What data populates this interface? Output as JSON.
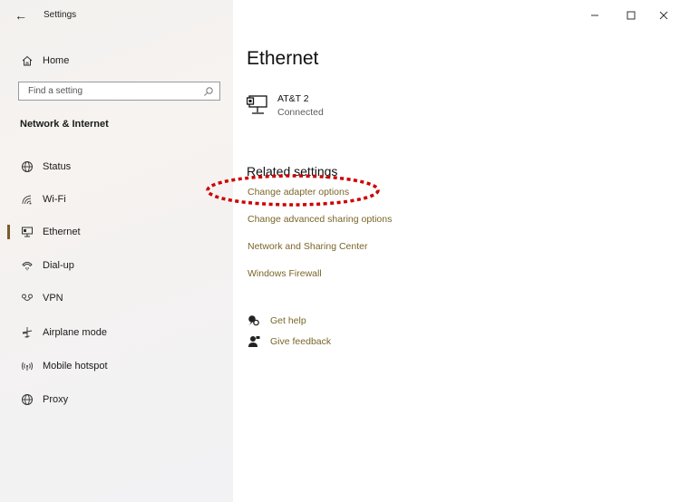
{
  "titlebar": {
    "back_icon": "back-arrow-icon",
    "title": "Settings"
  },
  "window_controls": {
    "minimize": "minimize-icon",
    "maximize": "maximize-icon",
    "close": "close-icon"
  },
  "sidebar": {
    "home_label": "Home",
    "search": {
      "placeholder": "Find a setting",
      "value": ""
    },
    "section_header": "Network & Internet",
    "items": [
      {
        "label": "Status",
        "icon": "globe-status-icon"
      },
      {
        "label": "Wi-Fi",
        "icon": "wifi-icon"
      },
      {
        "label": "Ethernet",
        "icon": "ethernet-icon",
        "selected": true
      },
      {
        "label": "Dial-up",
        "icon": "dial-up-icon"
      },
      {
        "label": "VPN",
        "icon": "vpn-icon"
      },
      {
        "label": "Airplane mode",
        "icon": "airplane-icon"
      },
      {
        "label": "Mobile hotspot",
        "icon": "hotspot-icon"
      },
      {
        "label": "Proxy",
        "icon": "proxy-globe-icon"
      }
    ]
  },
  "main": {
    "page_title": "Ethernet",
    "network": {
      "name": "AT&T 2",
      "status": "Connected",
      "icon": "ethernet-monitor-icon"
    },
    "related_heading": "Related settings",
    "related_links": [
      "Change adapter options",
      "Change advanced sharing options",
      "Network and Sharing Center",
      "Windows Firewall"
    ],
    "help_links": [
      {
        "label": "Get help",
        "icon": "help-chat-icon"
      },
      {
        "label": "Give feedback",
        "icon": "feedback-person-icon"
      }
    ]
  },
  "colors": {
    "link": "#7a6628",
    "selection_bar": "#7a5c2a",
    "annotation_red": "#cc0000"
  }
}
